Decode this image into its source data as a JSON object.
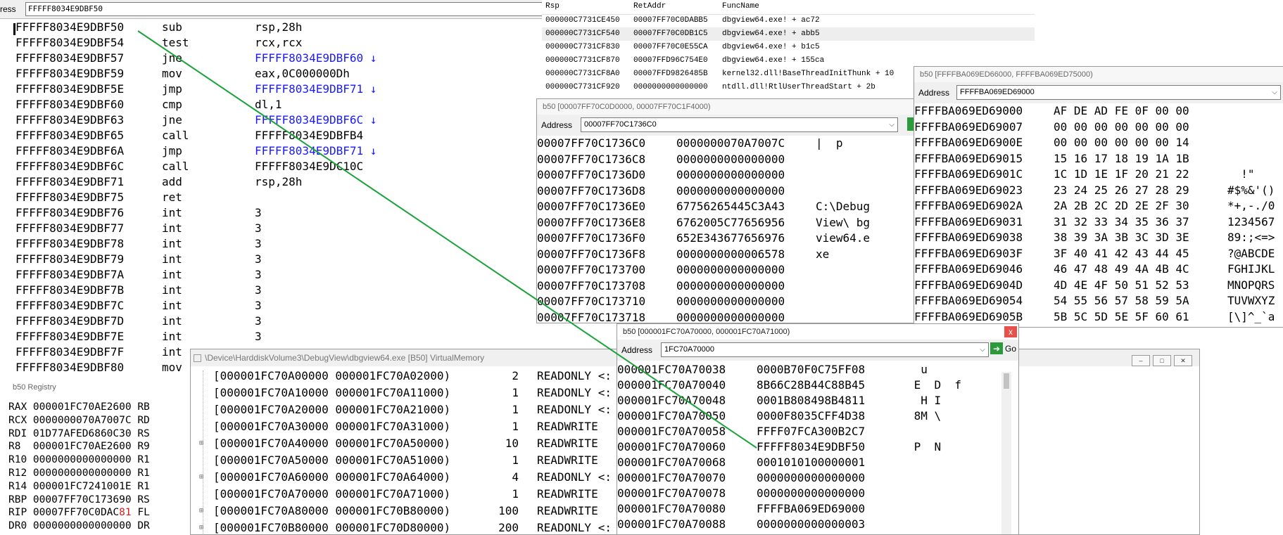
{
  "address_bar": {
    "label": "ress",
    "value": "FFFFF8034E9DBF50"
  },
  "disasm": [
    {
      "addr": "FFFFF8034E9DBF50",
      "mnem": "sub",
      "op": "rsp,28h",
      "link": false
    },
    {
      "addr": "FFFFF8034E9DBF54",
      "mnem": "test",
      "op": "rcx,rcx",
      "link": false
    },
    {
      "addr": "FFFFF8034E9DBF57",
      "mnem": "jne",
      "op": "FFFFF8034E9DBF60 ↓",
      "link": true
    },
    {
      "addr": "FFFFF8034E9DBF59",
      "mnem": "mov",
      "op": "eax,0C000000Dh",
      "link": false
    },
    {
      "addr": "FFFFF8034E9DBF5E",
      "mnem": "jmp",
      "op": "FFFFF8034E9DBF71 ↓",
      "link": true
    },
    {
      "addr": "FFFFF8034E9DBF60",
      "mnem": "cmp",
      "op": "dl,1",
      "link": false
    },
    {
      "addr": "FFFFF8034E9DBF63",
      "mnem": "jne",
      "op": "FFFFF8034E9DBF6C ↓",
      "link": true
    },
    {
      "addr": "FFFFF8034E9DBF65",
      "mnem": "call",
      "op": "FFFFF8034E9DBFB4",
      "link": false
    },
    {
      "addr": "FFFFF8034E9DBF6A",
      "mnem": "jmp",
      "op": "FFFFF8034E9DBF71 ↓",
      "link": true
    },
    {
      "addr": "FFFFF8034E9DBF6C",
      "mnem": "call",
      "op": "FFFFF8034E9DC10C",
      "link": false
    },
    {
      "addr": "FFFFF8034E9DBF71",
      "mnem": "add",
      "op": "rsp,28h",
      "link": false
    },
    {
      "addr": "FFFFF8034E9DBF75",
      "mnem": "ret",
      "op": "",
      "link": false
    },
    {
      "addr": "FFFFF8034E9DBF76",
      "mnem": "int",
      "op": "3",
      "link": false
    },
    {
      "addr": "FFFFF8034E9DBF77",
      "mnem": "int",
      "op": "3",
      "link": false
    },
    {
      "addr": "FFFFF8034E9DBF78",
      "mnem": "int",
      "op": "3",
      "link": false
    },
    {
      "addr": "FFFFF8034E9DBF79",
      "mnem": "int",
      "op": "3",
      "link": false
    },
    {
      "addr": "FFFFF8034E9DBF7A",
      "mnem": "int",
      "op": "3",
      "link": false
    },
    {
      "addr": "FFFFF8034E9DBF7B",
      "mnem": "int",
      "op": "3",
      "link": false
    },
    {
      "addr": "FFFFF8034E9DBF7C",
      "mnem": "int",
      "op": "3",
      "link": false
    },
    {
      "addr": "FFFFF8034E9DBF7D",
      "mnem": "int",
      "op": "3",
      "link": false
    },
    {
      "addr": "FFFFF8034E9DBF7E",
      "mnem": "int",
      "op": "3",
      "link": false
    },
    {
      "addr": "FFFFF8034E9DBF7F",
      "mnem": "int",
      "op": "",
      "link": false
    },
    {
      "addr": "FFFFF8034E9DBF80",
      "mnem": "mov",
      "op": "",
      "link": false
    }
  ],
  "stack": {
    "headers": [
      "Rsp",
      "RetAddr",
      "FuncName"
    ],
    "rows": [
      [
        "000000C7731CE450",
        "00007FF70C0DABB5",
        "dbgview64.exe! + ac72"
      ],
      [
        "000000C7731CF540",
        "00007FF70C0DB1C5",
        "dbgview64.exe! + abb5"
      ],
      [
        "000000C7731CF830",
        "00007FF70C0E55CA",
        "dbgview64.exe! + b1c5"
      ],
      [
        "000000C7731CF870",
        "00007FFD96C754E0",
        "dbgview64.exe! + 155ca"
      ],
      [
        "000000C7731CF8A0",
        "00007FFD9826485B",
        "kernel32.dll!BaseThreadInitThunk + 10"
      ],
      [
        "000000C7731CF920",
        "0000000000000000",
        "ntdll.dll!RtlUserThreadStart + 2b"
      ]
    ]
  },
  "mem_a": {
    "title": "b50 [00007FF70C0D0000, 00007FF70C1F4000)",
    "address_label": "Address",
    "address_value": "00007FF70C1736C0",
    "rows": [
      [
        "00007FF70C1736C0",
        "0000000070A7007C",
        "|  p"
      ],
      [
        "00007FF70C1736C8",
        "0000000000000000",
        ""
      ],
      [
        "00007FF70C1736D0",
        "0000000000000000",
        ""
      ],
      [
        "00007FF70C1736D8",
        "0000000000000000",
        ""
      ],
      [
        "00007FF70C1736E0",
        "67756265445C3A43",
        "C:\\Debug"
      ],
      [
        "00007FF70C1736E8",
        "6762005C77656956",
        "View\\ bg"
      ],
      [
        "00007FF70C1736F0",
        "652E343677656976",
        "view64.e"
      ],
      [
        "00007FF70C1736F8",
        "0000000000006578",
        "xe"
      ],
      [
        "00007FF70C173700",
        "0000000000000000",
        ""
      ],
      [
        "00007FF70C173708",
        "0000000000000000",
        ""
      ],
      [
        "00007FF70C173710",
        "0000000000000000",
        ""
      ],
      [
        "00007FF70C173718",
        "0000000000000000",
        ""
      ]
    ]
  },
  "mem_b": {
    "title": "b50 [FFFFBA069ED66000, FFFFBA069ED75000)",
    "address_label": "Address",
    "address_value": "FFFFBA069ED69000",
    "rows": [
      [
        "FFFFBA069ED69000",
        "AF DE AD FE 0F 00 00",
        ""
      ],
      [
        "FFFFBA069ED69007",
        "00 00 00 00 00 00 00",
        ""
      ],
      [
        "FFFFBA069ED6900E",
        "00 00 00 00 00 00 14",
        ""
      ],
      [
        "FFFFBA069ED69015",
        "15 16 17 18 19 1A 1B",
        ""
      ],
      [
        "FFFFBA069ED6901C",
        "1C 1D 1E 1F 20 21 22",
        "  !\""
      ],
      [
        "FFFFBA069ED69023",
        "23 24 25 26 27 28 29",
        "#$%&'()"
      ],
      [
        "FFFFBA069ED6902A",
        "2A 2B 2C 2D 2E 2F 30",
        "*+,-./0"
      ],
      [
        "FFFFBA069ED69031",
        "31 32 33 34 35 36 37",
        "1234567"
      ],
      [
        "FFFFBA069ED69038",
        "38 39 3A 3B 3C 3D 3E",
        "89:;<=>"
      ],
      [
        "FFFFBA069ED6903F",
        "3F 40 41 42 43 44 45",
        "?@ABCDE"
      ],
      [
        "FFFFBA069ED69046",
        "46 47 48 49 4A 4B 4C",
        "FGHIJKL"
      ],
      [
        "FFFFBA069ED6904D",
        "4D 4E 4F 50 51 52 53",
        "MNOPQRS"
      ],
      [
        "FFFFBA069ED69054",
        "54 55 56 57 58 59 5A",
        "TUVWXYZ"
      ],
      [
        "FFFFBA069ED6905B",
        "5B 5C 5D 5E 5F 60 61",
        "[\\]^_`a"
      ]
    ]
  },
  "mem_c": {
    "title": "b50 [000001FC70A70000, 000001FC70A71000)",
    "address_label": "Address",
    "address_value": "1FC70A70000",
    "go_label": "Go",
    "close_glyph": "x",
    "rows": [
      [
        "000001FC70A70038",
        "0000B70F0C75FF08",
        "  u"
      ],
      [
        "000001FC70A70040",
        "8B66C28B44C88B45",
        " E  D  f"
      ],
      [
        "000001FC70A70048",
        "0001B808498B4811",
        "  H I"
      ],
      [
        "000001FC70A70050",
        "0000F8035CFF4D38",
        " 8M \\"
      ],
      [
        "000001FC70A70058",
        "FFFF07FCA300B2C7",
        ""
      ],
      [
        "000001FC70A70060",
        "FFFFF8034E9DBF50",
        " P  N"
      ],
      [
        "000001FC70A70068",
        "0001010100000001",
        ""
      ],
      [
        "000001FC70A70070",
        "0000000000000000",
        ""
      ],
      [
        "000001FC70A70078",
        "0000000000000000",
        ""
      ],
      [
        "000001FC70A70080",
        "FFFFBA069ED69000",
        ""
      ],
      [
        "000001FC70A70088",
        "0000000000000003",
        ""
      ]
    ]
  },
  "registry": {
    "title": "b50 Registry",
    "rows": [
      [
        {
          "t": "RAX 000001FC70AE2600 RB"
        }
      ],
      [
        {
          "t": "RCX 0000000070A7007C RD"
        }
      ],
      [
        {
          "t": "RDI 01D77AFED6860C30 RS"
        }
      ],
      [
        {
          "t": "R8  000001FC70AE2600 R9"
        }
      ],
      [
        {
          "t": "R10 0000000000000000 R1"
        }
      ],
      [
        {
          "t": "R12 0000000000000000 R1"
        }
      ],
      [
        {
          "t": "R14 000001FC7241001E R1"
        }
      ],
      [
        {
          "t": "RBP 00007FF70C173690 RS"
        }
      ],
      [
        {
          "t": "RIP 00007FF70C0DAC"
        },
        {
          "t": "81",
          "red": true
        },
        {
          "t": " FL"
        }
      ],
      [
        {
          "t": "DR0 0000000000000000 DR"
        }
      ]
    ]
  },
  "vm": {
    "title": "\\Device\\HarddiskVolume3\\DebugView\\dbgview64.exe [B50] VirtualMemory",
    "rows": [
      {
        "exp": "",
        "range": "[000001FC70A00000 000001FC70A02000)",
        "n": "2",
        "prot": "READONLY <:"
      },
      {
        "exp": "",
        "range": "[000001FC70A10000 000001FC70A11000)",
        "n": "1",
        "prot": "READONLY <:"
      },
      {
        "exp": "",
        "range": "[000001FC70A20000 000001FC70A21000)",
        "n": "1",
        "prot": "READONLY <:"
      },
      {
        "exp": "",
        "range": "[000001FC70A30000 000001FC70A31000)",
        "n": "1",
        "prot": "READWRITE"
      },
      {
        "exp": "⊞",
        "range": "[000001FC70A40000 000001FC70A50000)",
        "n": "10",
        "prot": "READWRITE"
      },
      {
        "exp": "",
        "range": "[000001FC70A50000 000001FC70A51000)",
        "n": "1",
        "prot": "READWRITE"
      },
      {
        "exp": "⊞",
        "range": "[000001FC70A60000 000001FC70A64000)",
        "n": "4",
        "prot": "READONLY <:"
      },
      {
        "exp": "",
        "range": "[000001FC70A70000 000001FC70A71000)",
        "n": "1",
        "prot": "READWRITE"
      },
      {
        "exp": "⊞",
        "range": "[000001FC70A80000 000001FC70B80000)",
        "n": "100",
        "prot": "READWRITE"
      },
      {
        "exp": "⊞",
        "range": "[000001FC70B80000 000001FC70D80000)",
        "n": "200",
        "prot": "READONLY <:"
      }
    ]
  },
  "colors": {
    "link_blue": "#1a1aff",
    "arrow_green": "#1aa33a",
    "highlight_red": "#d0201a"
  }
}
